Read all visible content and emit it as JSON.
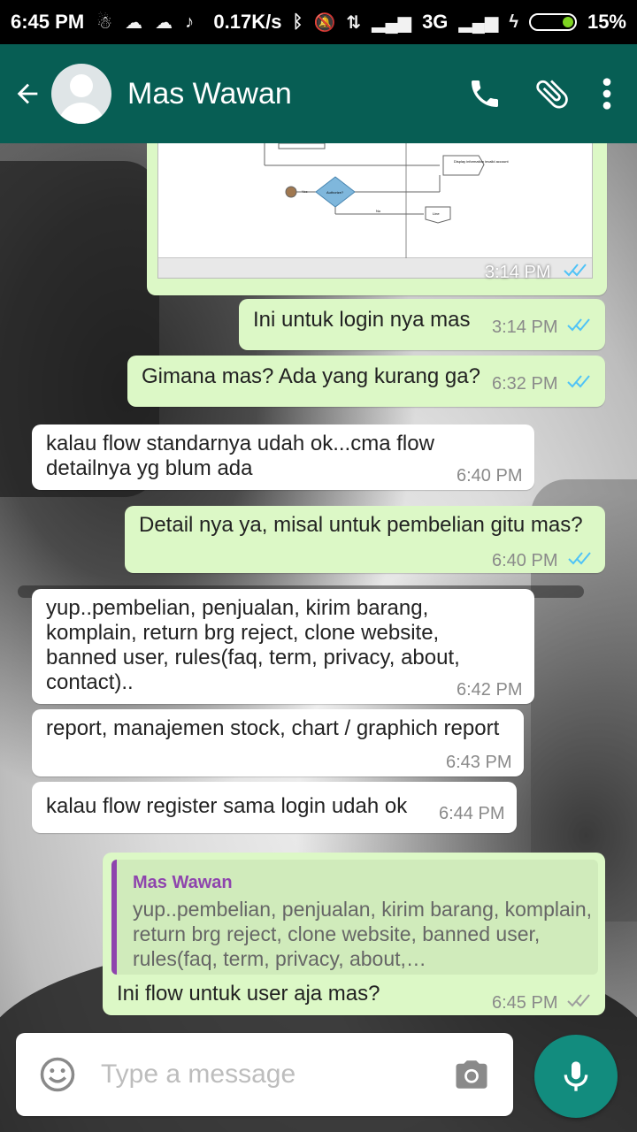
{
  "status_bar": {
    "time": "6:45 PM",
    "speed": "0.17K/s",
    "network": "3G",
    "battery": "15%"
  },
  "header": {
    "contact_name": "Mas Wawan",
    "avatar_icon": "default-avatar-icon",
    "back_icon": "arrow-left-icon",
    "call_icon": "phone-icon",
    "attach_icon": "paperclip-icon",
    "menu_icon": "more-vertical-icon"
  },
  "image_message": {
    "time": "3:14 PM",
    "diagram_labels": {
      "display": "Display information invalid account",
      "decision": "Authorize?",
      "yes": "Yes",
      "no": "No",
      "end": "Line"
    }
  },
  "messages": [
    {
      "text": "Ini untuk login nya mas",
      "time": "3:14 PM",
      "direction": "out"
    },
    {
      "text": "Gimana mas? Ada yang kurang ga?",
      "time": "6:32 PM",
      "direction": "out"
    },
    {
      "text": "kalau flow standarnya udah ok...cma flow detailnya yg blum ada",
      "time": "6:40 PM",
      "direction": "in"
    },
    {
      "text": "Detail nya ya, misal untuk pembelian gitu mas?",
      "time": "6:40 PM",
      "direction": "out"
    },
    {
      "text": "yup..pembelian, penjualan, kirim barang, komplain, return brg reject, clone website, banned user, rules(faq, term, privacy, about, contact)..",
      "time": "6:42 PM",
      "direction": "in"
    },
    {
      "text": "report, manajemen stock, chart / graphich report",
      "time": "6:43 PM",
      "direction": "in"
    },
    {
      "text": "kalau flow register sama login udah ok",
      "time": "6:44 PM",
      "direction": "in"
    }
  ],
  "reply_message": {
    "quoted_name": "Mas Wawan",
    "quoted_text": "yup..pembelian, penjualan, kirim barang, komplain, return brg reject, clone website, banned user, rules(faq, term, privacy, about,…",
    "text": "Ini flow untuk user aja mas?",
    "time": "6:45 PM"
  },
  "input": {
    "placeholder": "Type a message",
    "emoji_icon": "smiley-icon",
    "camera_icon": "camera-icon",
    "mic_icon": "microphone-icon"
  },
  "colors": {
    "header": "#075e54",
    "outgoing_bubble": "#dcf8c6",
    "incoming_bubble": "#ffffff",
    "read_ticks": "#4fc3f7",
    "mic_button": "#128c7e",
    "quote_accent": "#8e44ad"
  }
}
